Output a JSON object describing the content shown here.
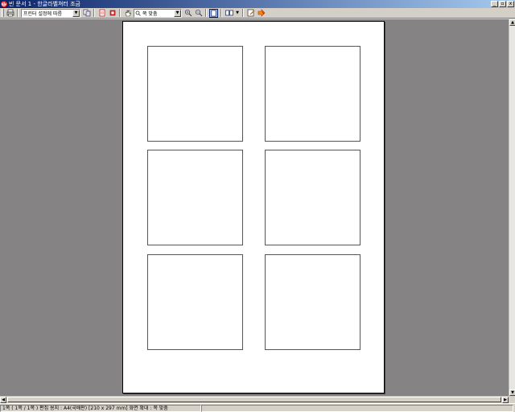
{
  "window": {
    "title": "빈 문서 1 - 한글라벨쳐터 조금",
    "app_icon": "hwp-app-icon",
    "controls": [
      "_",
      "▫",
      "x"
    ]
  },
  "toolbar": {
    "printer_combo_value": "프린터 설정에 따름",
    "zoom_combo_value": "쪽 맞춤",
    "icons": [
      "print-icon",
      "copy-icon",
      "page-setup-icon",
      "stop-icon",
      "hand-icon",
      "zoom-in-icon",
      "zoom-out-icon",
      "single-page-icon",
      "multi-page-icon",
      "edit-icon",
      "close-preview-icon"
    ]
  },
  "document": {
    "paper_color": "#ffffff",
    "background_color": "#858384",
    "label_grid": {
      "rows": 3,
      "columns": 2,
      "count": 6
    }
  },
  "statusbar": {
    "text": "1쪽 ( 1쪽 / 1쪽 ) 편집 용지 : A4(국배판)  [210 x 297 mm]  화면 확대 : 쪽 맞춤"
  }
}
